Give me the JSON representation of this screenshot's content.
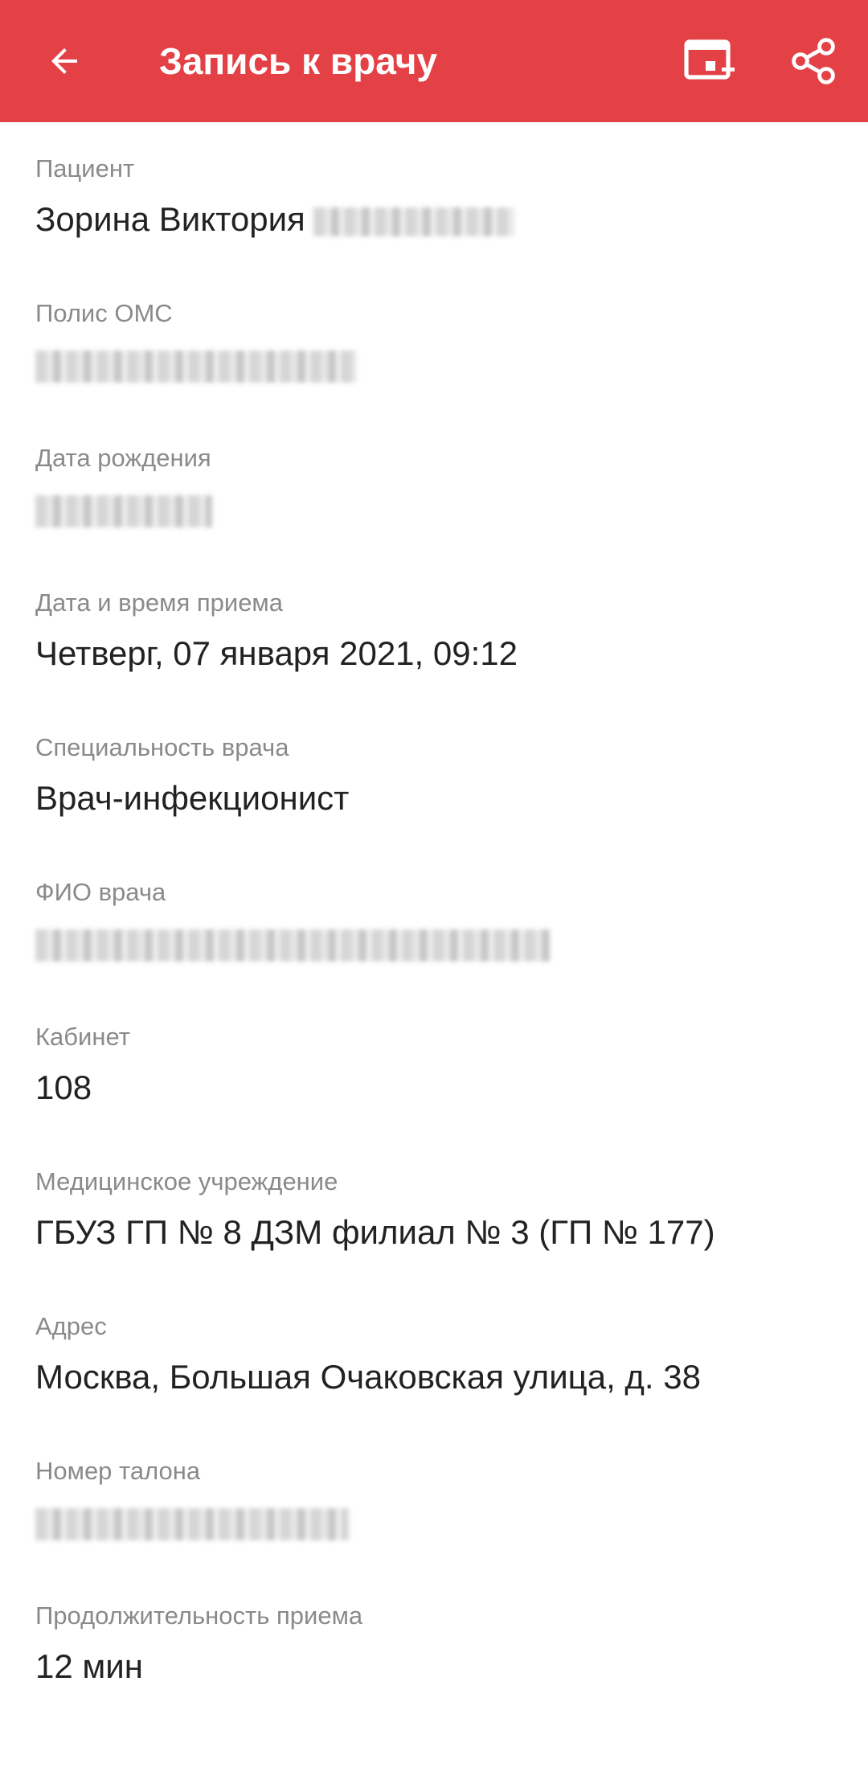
{
  "header": {
    "title": "Запись к врачу",
    "back_icon": "arrow-left-icon",
    "calendar_icon": "calendar-add-icon",
    "share_icon": "share-icon",
    "background_color": "#e34146"
  },
  "fields": {
    "patient": {
      "label": "Пациент",
      "value": "Зорина Виктория"
    },
    "policy": {
      "label": "Полис ОМС"
    },
    "birth_date": {
      "label": "Дата рождения"
    },
    "appointment_datetime": {
      "label": "Дата и время приема",
      "value": "Четверг, 07 января 2021, 09:12"
    },
    "specialty": {
      "label": "Специальность врача",
      "value": "Врач-инфекционист"
    },
    "doctor_name": {
      "label": "ФИО врача"
    },
    "office": {
      "label": "Кабинет",
      "value": "108"
    },
    "institution": {
      "label": "Медицинское учреждение",
      "value": "ГБУЗ ГП № 8 ДЗМ филиал № 3 (ГП № 177)"
    },
    "address": {
      "label": "Адрес",
      "value": "Москва, Большая Очаковская улица, д. 38"
    },
    "ticket_number": {
      "label": "Номер талона"
    },
    "duration": {
      "label": "Продолжительность приема",
      "value": "12 мин"
    }
  }
}
